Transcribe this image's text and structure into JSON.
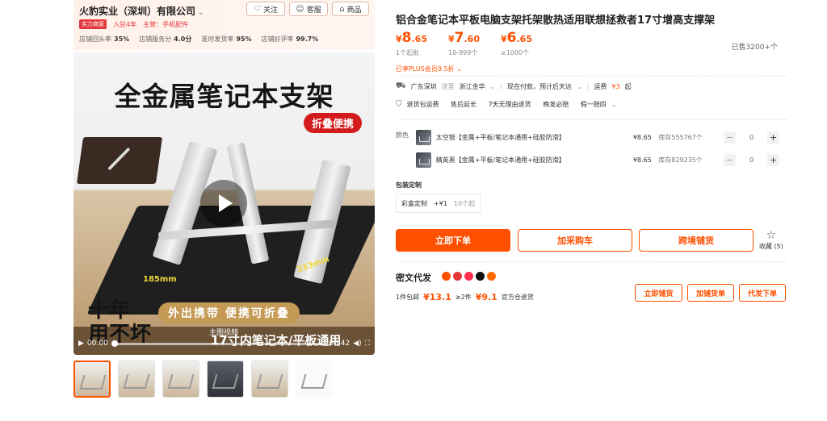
{
  "shop": {
    "name": "火豹实业（深圳）有限公司",
    "follow_label": "关注",
    "service_label": "客服",
    "products_label": "商品",
    "badge": "实力商家",
    "years": "入驻4年",
    "main_business": "主营：手机配件",
    "metrics": [
      {
        "label": "店铺回头率",
        "value": "35%"
      },
      {
        "label": "店铺服务分",
        "value": "4.0分"
      },
      {
        "label": "准时发货率",
        "value": "95%"
      },
      {
        "label": "店铺好评率",
        "value": "99.7%"
      }
    ]
  },
  "hero": {
    "title": "全金属笔记本支架",
    "tag": "折叠便携",
    "dim_left": "185mm",
    "dim_right": "233mm",
    "bottom_big": "十年\n用不坏",
    "bottom_pill": "外出携带  便携可折叠",
    "bottom_strip": "17寸内笔记本/平板通用",
    "caption": "主图视频",
    "time_left": "00:00",
    "time_right": "00:42"
  },
  "product": {
    "title": "铝合金笔记本平板电脑支架托架散热适用联想拯救者17寸增高支撑架",
    "currency": "¥",
    "tiers": [
      {
        "price_int": "8",
        "price_dec": ".65",
        "cond": "1个起批"
      },
      {
        "price_int": "7",
        "price_dec": ".60",
        "cond": "10-999个"
      },
      {
        "price_int": "6",
        "price_dec": ".65",
        "cond": "≥1000个"
      }
    ],
    "sold": "已售3200+个",
    "plus": "已享PLUS会员9.5折"
  },
  "shipping": {
    "from": "广东深圳",
    "to_label": "送至",
    "to": "浙江金华",
    "pay": "现在付款，预计后天达",
    "freight_label": "运费",
    "freight": "¥3",
    "freight_suffix": "起"
  },
  "services": [
    "退货包运费",
    "售后延长",
    "7天无理由退货",
    "晚发必赔",
    "假一赔四"
  ],
  "sku": {
    "label": "颜色",
    "items": [
      {
        "name": "太空银【金属+平板/笔记本通用+硅胶防滑】",
        "price": "¥8.65",
        "stock": "库存555767个",
        "qty": "0"
      },
      {
        "name": "精英黑【金属+平板/笔记本通用+硅胶防滑】",
        "price": "¥8.65",
        "stock": "库存829235个",
        "qty": "0"
      }
    ]
  },
  "packaging": {
    "label": "包装定制",
    "option": "彩盒定制",
    "add": "+¥1",
    "min": "10个起"
  },
  "actions": {
    "buy": "立即下单",
    "cart": "加采购车",
    "cross": "跨境铺货",
    "fav": "收藏",
    "fav_count": "(5)"
  },
  "dropship": {
    "title": "密文代发",
    "free_label": "1件包邮",
    "free_price": "¥13.1",
    "two_label": "≥2件",
    "two_price": "¥9.1",
    "return": "官方仓退货",
    "btn1": "立即铺货",
    "btn2": "加铺货单",
    "btn3": "代发下单"
  },
  "colors": {
    "accent": "#ff5000",
    "red": "#e4393c"
  }
}
